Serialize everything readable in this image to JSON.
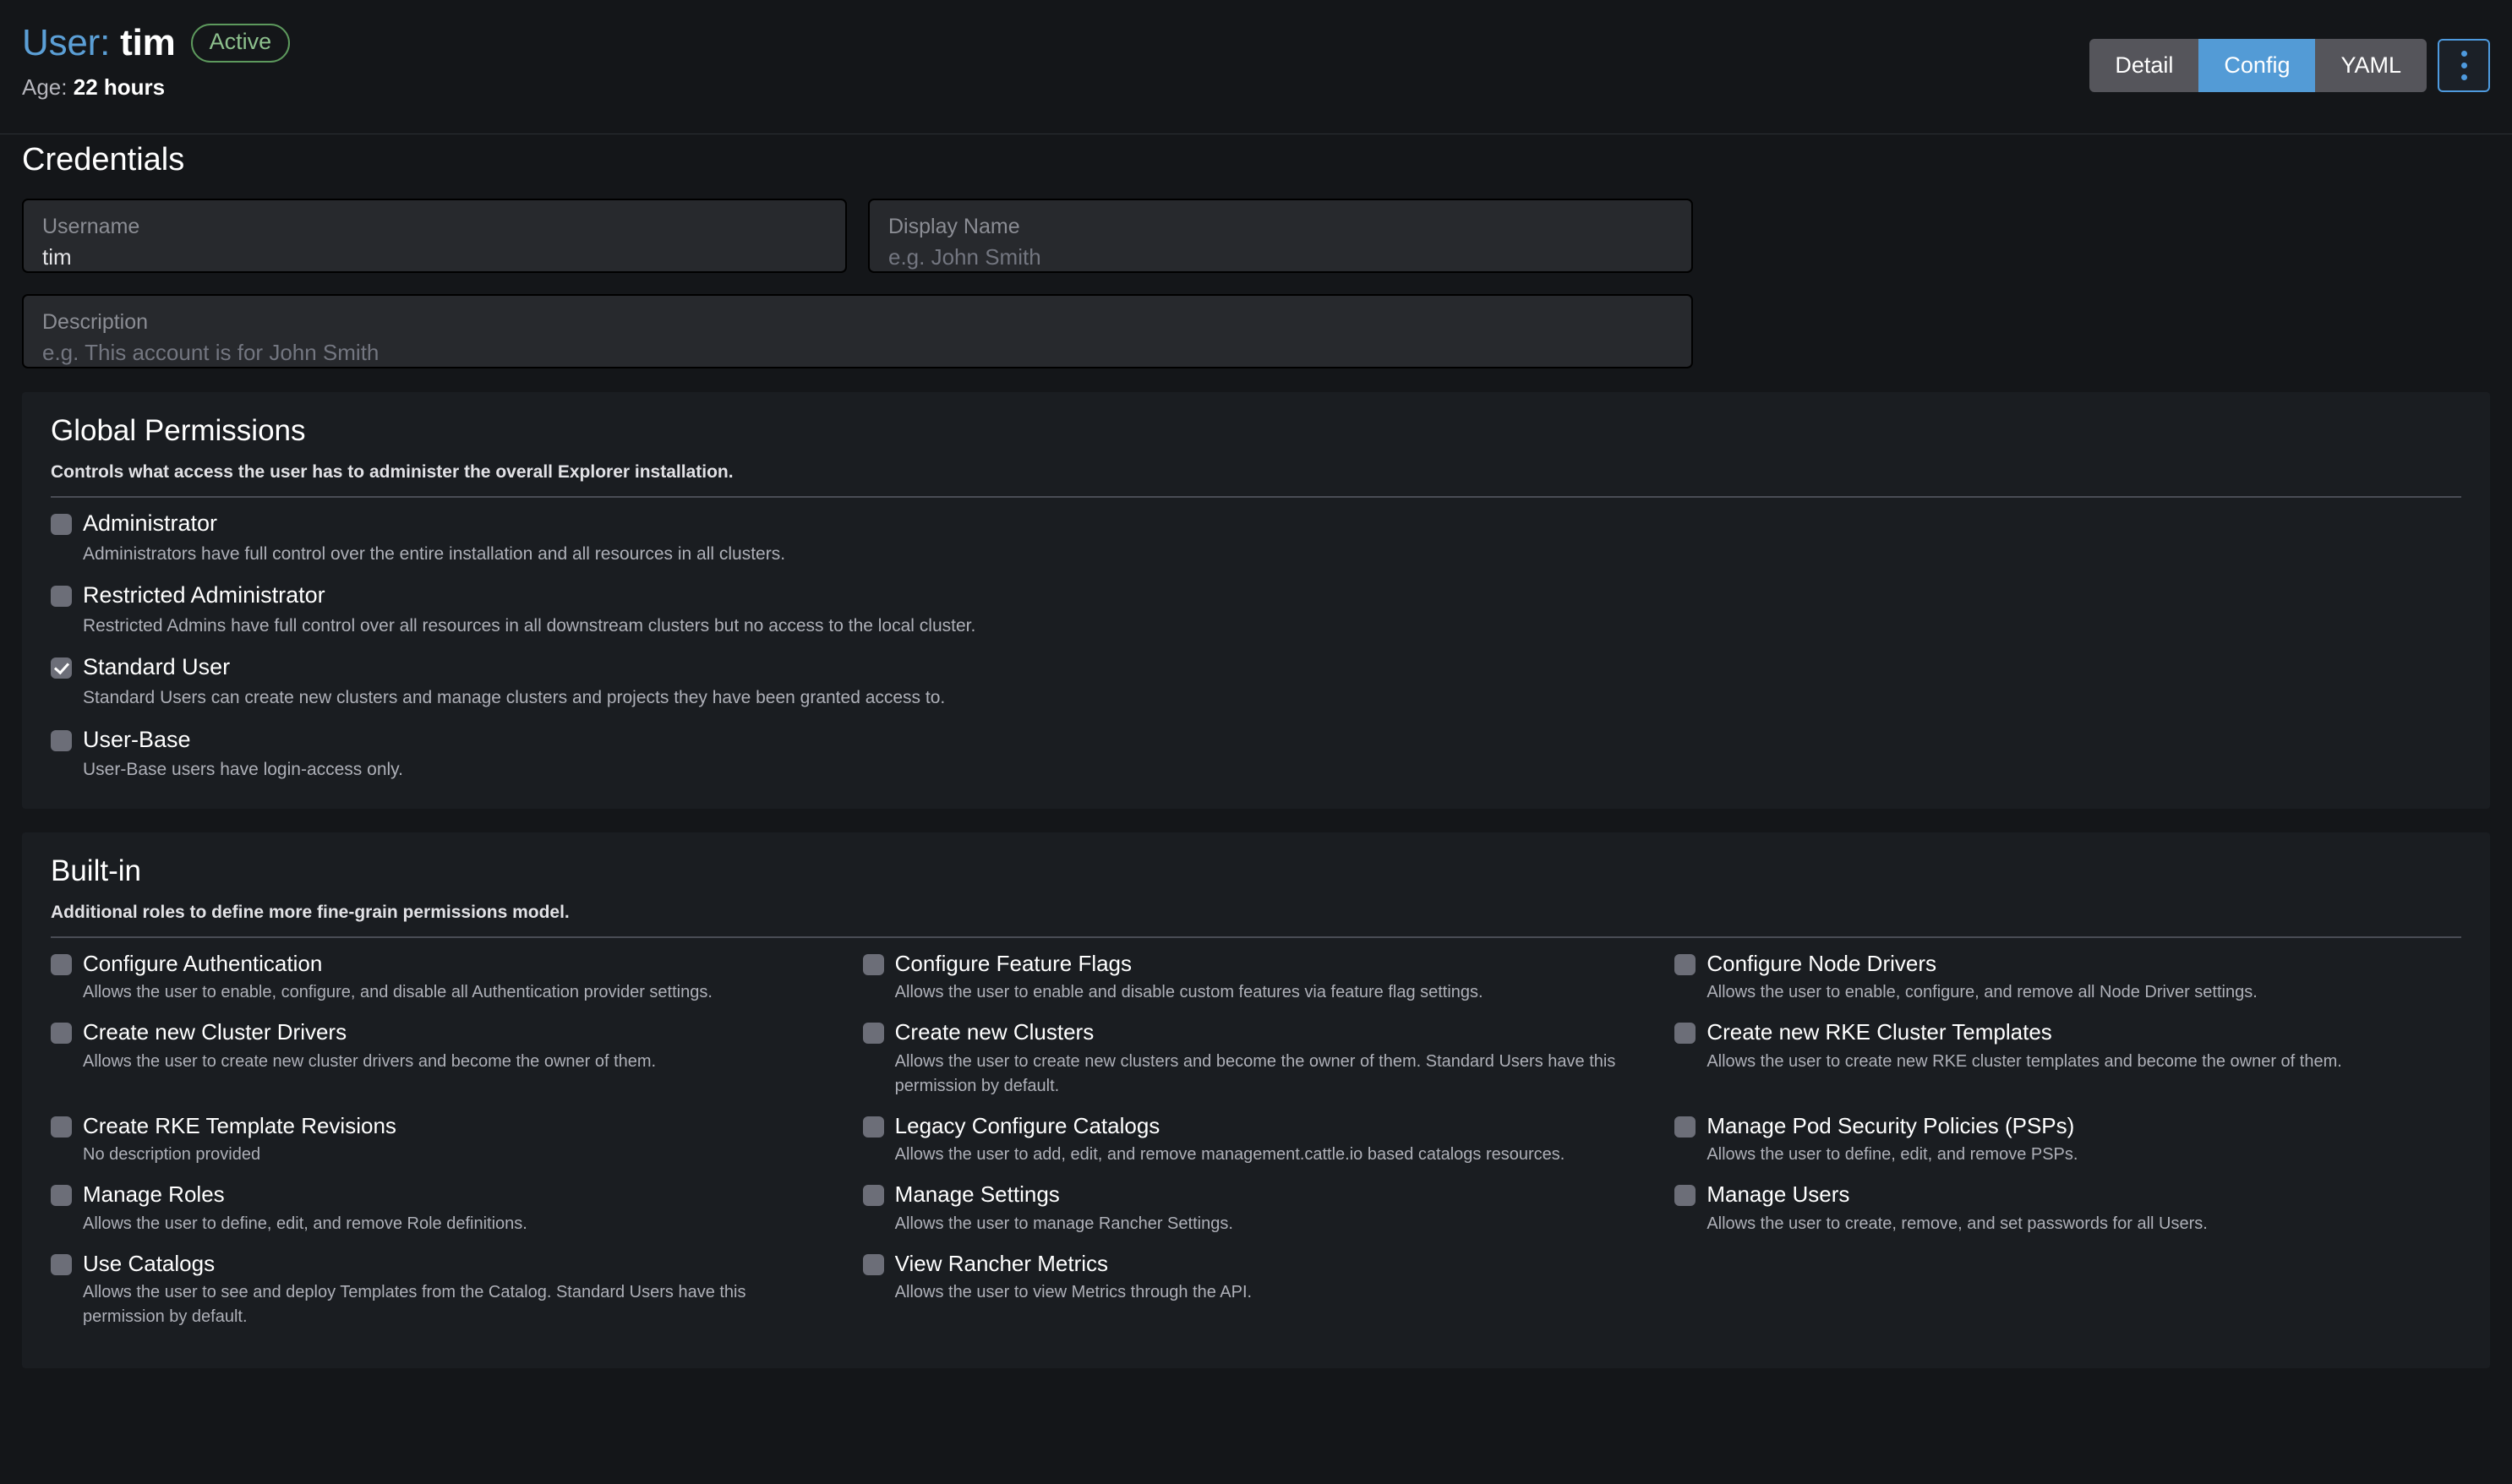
{
  "header": {
    "kind_label": "User:",
    "name": "tim",
    "state_badge": "Active",
    "age_label": "Age:",
    "age_value": "22 hours",
    "views": [
      {
        "label": "Detail",
        "active": false
      },
      {
        "label": "Config",
        "active": true
      },
      {
        "label": "YAML",
        "active": false
      }
    ],
    "actions_menu_icon": "kebab-menu-icon"
  },
  "credentials": {
    "title": "Credentials",
    "username": {
      "label": "Username",
      "value": "tim"
    },
    "display_name": {
      "label": "Display Name",
      "placeholder": "e.g. John Smith"
    },
    "description": {
      "label": "Description",
      "placeholder": "e.g. This account is for John Smith"
    }
  },
  "global_permissions": {
    "title": "Global Permissions",
    "subtitle": "Controls what access the user has to administer the overall Explorer installation.",
    "items": [
      {
        "label": "Administrator",
        "description": "Administrators have full control over the entire installation and all resources in all clusters.",
        "checked": false
      },
      {
        "label": "Restricted Administrator",
        "description": "Restricted Admins have full control over all resources in all downstream clusters but no access to the local cluster.",
        "checked": false
      },
      {
        "label": "Standard User",
        "description": "Standard Users can create new clusters and manage clusters and projects they have been granted access to.",
        "checked": true
      },
      {
        "label": "User-Base",
        "description": "User-Base users have login-access only.",
        "checked": false
      }
    ]
  },
  "builtin": {
    "title": "Built-in",
    "subtitle": "Additional roles to define more fine-grain permissions model.",
    "columns": [
      [
        {
          "label": "Configure Authentication",
          "description": "Allows the user to enable, configure, and disable all Authentication provider settings.",
          "checked": false
        },
        {
          "label": "Create new Cluster Drivers",
          "description": "Allows the user to create new cluster drivers and become the owner of them.",
          "checked": false
        },
        {
          "label": "Create RKE Template Revisions",
          "description": "No description provided",
          "checked": false
        },
        {
          "label": "Manage Roles",
          "description": "Allows the user to define, edit, and remove Role definitions.",
          "checked": false
        },
        {
          "label": "Use Catalogs",
          "description": "Allows the user to see and deploy Templates from the Catalog. Standard Users have this permission by default.",
          "checked": false
        }
      ],
      [
        {
          "label": "Configure Feature Flags",
          "description": "Allows the user to enable and disable custom features via feature flag settings.",
          "checked": false
        },
        {
          "label": "Create new Clusters",
          "description": "Allows the user to create new clusters and become the owner of them. Standard Users have this permission by default.",
          "checked": false
        },
        {
          "label": "Legacy Configure Catalogs",
          "description": "Allows the user to add, edit, and remove management.cattle.io based catalogs resources.",
          "checked": false
        },
        {
          "label": "Manage Settings",
          "description": "Allows the user to manage Rancher Settings.",
          "checked": false
        },
        {
          "label": "View Rancher Metrics",
          "description": "Allows the user to view Metrics through the API.",
          "checked": false
        }
      ],
      [
        {
          "label": "Configure Node Drivers",
          "description": "Allows the user to enable, configure, and remove all Node Driver settings.",
          "checked": false
        },
        {
          "label": "Create new RKE Cluster Templates",
          "description": "Allows the user to create new RKE cluster templates and become the owner of them.",
          "checked": false
        },
        {
          "label": "Manage Pod Security Policies (PSPs)",
          "description": "Allows the user to define, edit, and remove PSPs.",
          "checked": false
        },
        {
          "label": "Manage Users",
          "description": "Allows the user to create, remove, and set passwords for all Users.",
          "checked": false
        }
      ]
    ]
  },
  "colors": {
    "accent": "#539bd6",
    "page_bg": "#141619",
    "card_bg": "#1a1d21",
    "badge_green": "#8dc08d"
  }
}
